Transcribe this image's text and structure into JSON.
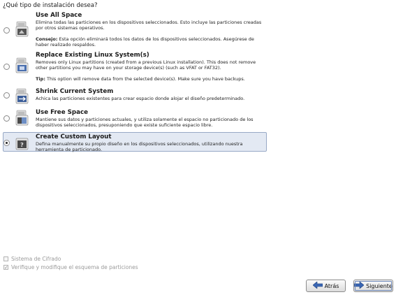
{
  "question": "¿Qué tipo de instalación desea?",
  "options": [
    {
      "title": "Use All Space",
      "desc": "Elimina todas las particiones en los dispositivos seleccionados. Esto incluye las particiones creadas por otros sistemas operativos.",
      "tip_label": "Consejo:",
      "tip_text": " Esta opción eliminará todos los datos de los dispositivos seleccionados. Asegúrese de haber realizado respaldos.",
      "icon": "drive-delete-all-icon",
      "selected": false
    },
    {
      "title": "Replace Existing Linux System(s)",
      "desc": "Removes only Linux partitions (created from a previous Linux installation).  This does not remove other partitions you may have on your storage device(s) (such as VFAT or FAT32).",
      "tip_label": "Tip:",
      "tip_text": " This option will remove data from the selected device(s).  Make sure you have backups.",
      "icon": "drive-replace-linux-icon",
      "selected": false
    },
    {
      "title": "Shrink Current System",
      "desc": "Achica las particiones existentes para crear espacio donde alojar el diseño predeterminado.",
      "icon": "drive-shrink-icon",
      "selected": false
    },
    {
      "title": "Use Free Space",
      "desc": "Mantiene sus datos y particiones actuales, y utiliza solamente el espacio no particionado de los dispositivos seleccionados, presuponiendo que existe suficiente espacio libre.",
      "icon": "drive-free-space-icon",
      "selected": false
    },
    {
      "title": "Create Custom Layout",
      "desc": "Defina manualmente su propio diseño en los dispositivos seleccionados, utilizando nuestra herramienta de particionado.",
      "icon": "drive-custom-layout-icon",
      "selected": true
    }
  ],
  "checks": {
    "encrypt": {
      "label": "Sistema de Cifrado",
      "checked": false
    },
    "review": {
      "label": "Verifique y modifique el esquema de particiones",
      "checked": true
    }
  },
  "buttons": {
    "back": "Atrás",
    "next": "Siguiente"
  },
  "colors": {
    "selection_bg": "#e3e9f3",
    "selection_border": "#98a9c6",
    "arrow_blue": "#3a66b4"
  }
}
